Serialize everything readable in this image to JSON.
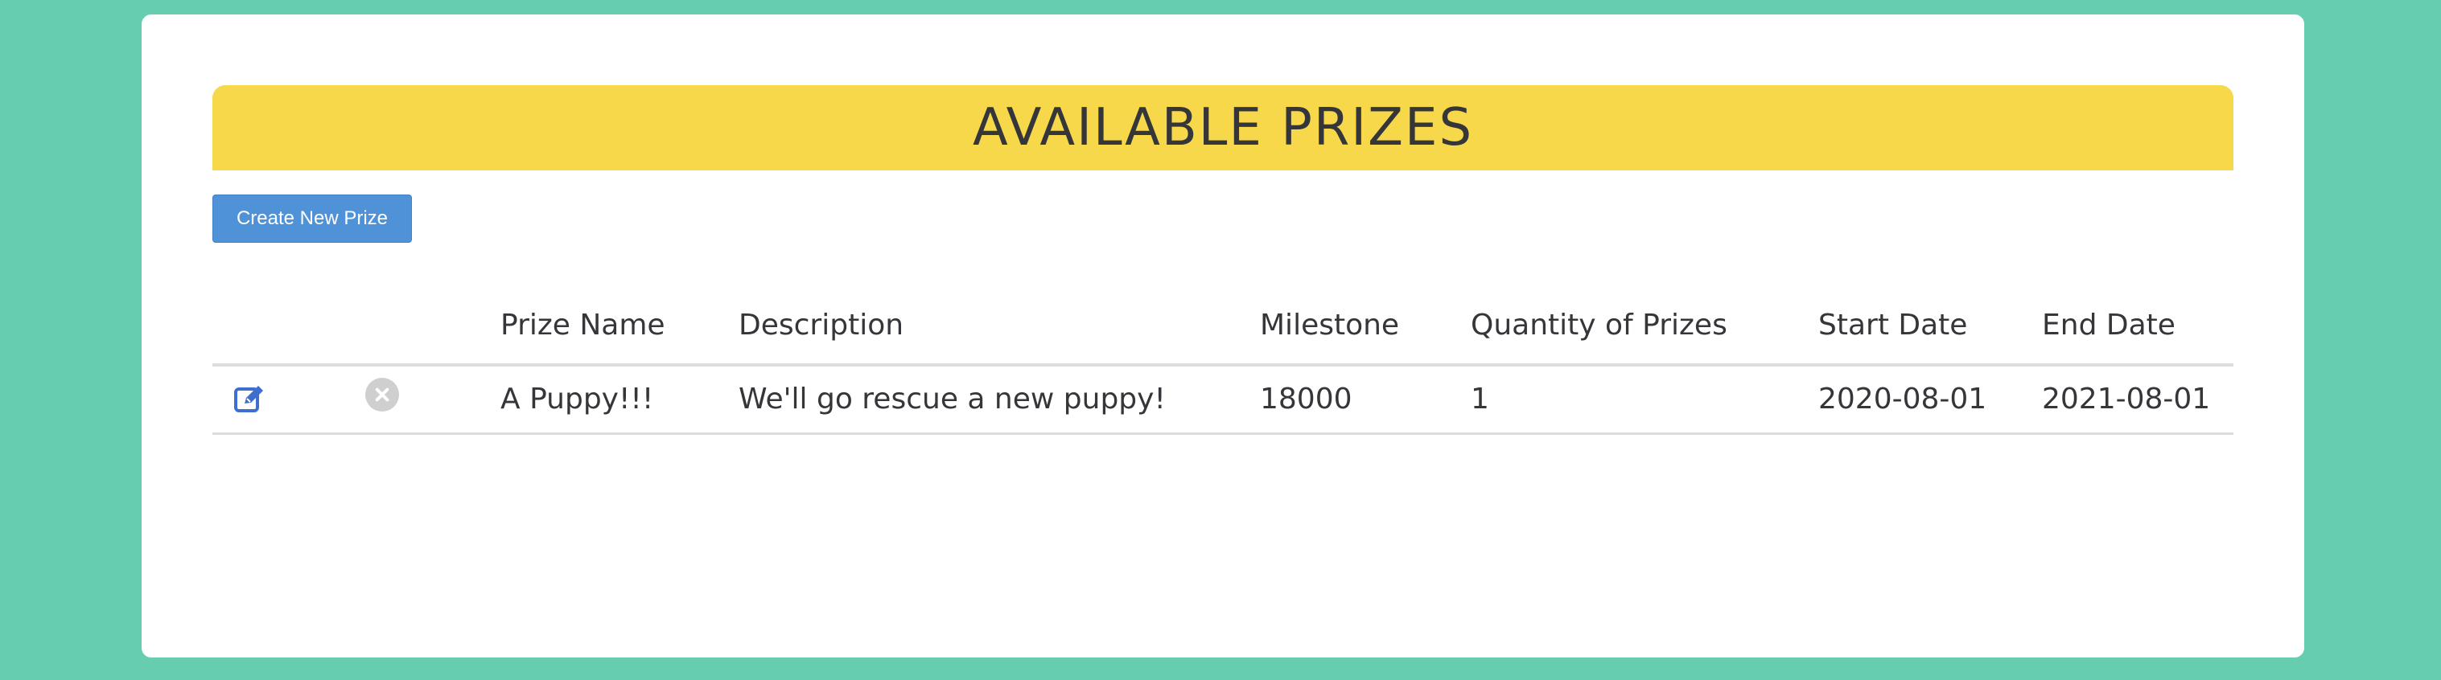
{
  "page": {
    "title": "AVAILABLE PRIZES"
  },
  "toolbar": {
    "create_label": "Create New Prize"
  },
  "table": {
    "headers": {
      "name": "Prize Name",
      "description": "Description",
      "milestone": "Milestone",
      "quantity": "Quantity of Prizes",
      "start_date": "Start Date",
      "end_date": "End Date"
    },
    "rows": [
      {
        "name": "A Puppy!!!",
        "description": "We'll go rescue a new puppy!",
        "milestone": "18000",
        "quantity": "1",
        "start_date": "2020-08-01",
        "end_date": "2021-08-01",
        "edit_icon": "edit-icon",
        "delete_icon": "delete-icon"
      }
    ]
  },
  "colors": {
    "background": "#66cdb1",
    "banner": "#f8d84b",
    "button": "#4f92d8",
    "edit_icon": "#3e6fd0",
    "delete_icon": "#cfcfcf"
  }
}
